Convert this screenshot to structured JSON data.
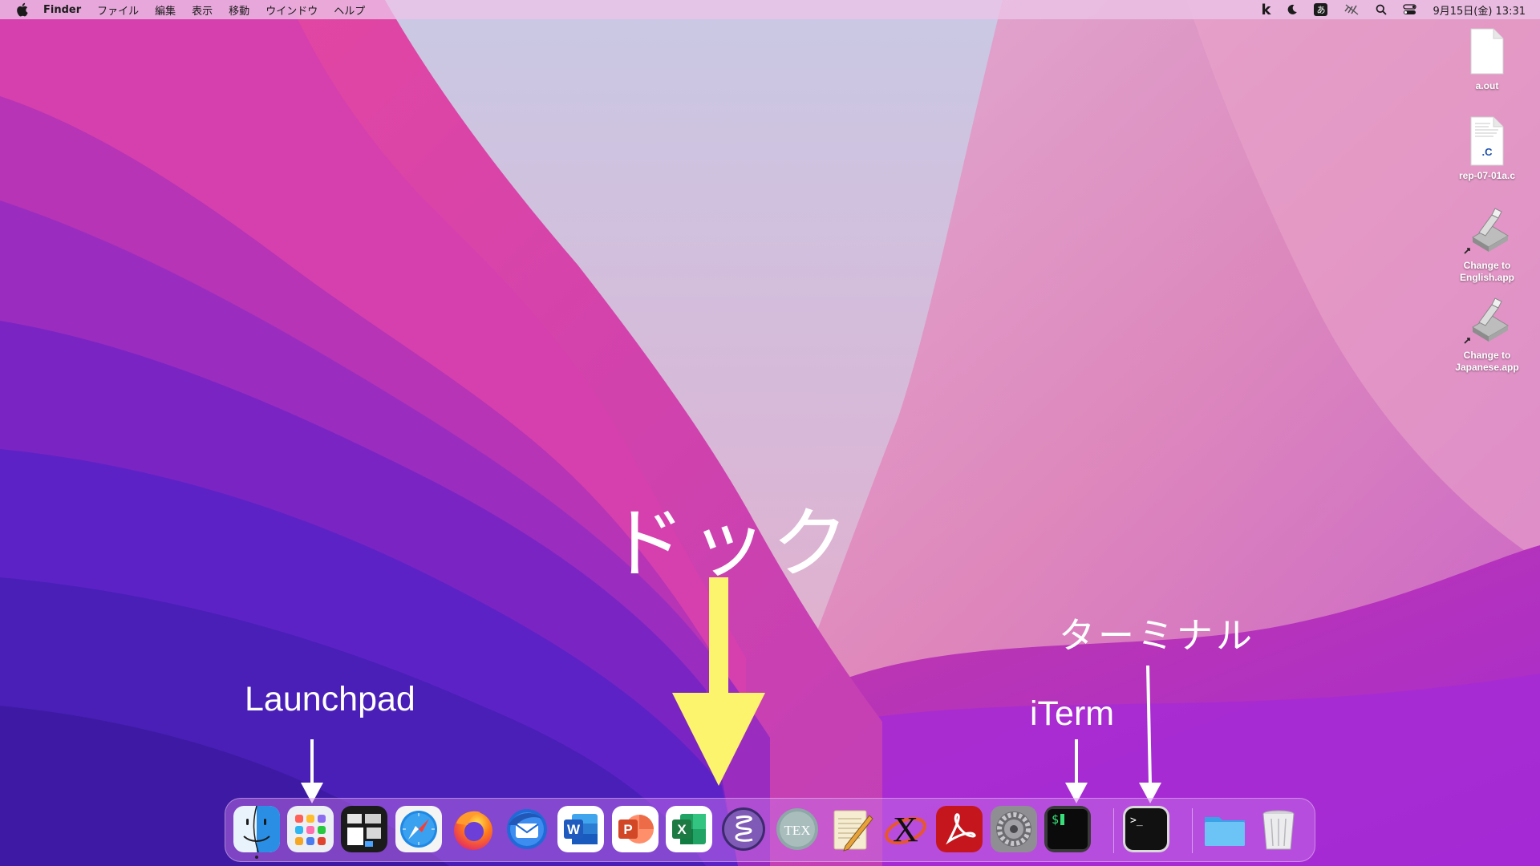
{
  "menubar": {
    "apple_icon": "apple-logo-icon",
    "app_name": "Finder",
    "menus": [
      "ファイル",
      "編集",
      "表示",
      "移動",
      "ウインドウ",
      "ヘルプ"
    ],
    "status_icons": [
      "k-icon",
      "moon-icon",
      "input-method-icon",
      "mute-icon",
      "search-icon",
      "control-center-icon"
    ],
    "input_method_glyph": "あ",
    "k_glyph": "k",
    "clock": "9月15日(金)  13:31"
  },
  "desktop_icons": [
    {
      "label": "a.out",
      "icon": "document-icon"
    },
    {
      "label": "rep-07-01a.c",
      "icon": "c-source-file-icon",
      "badge": ".C"
    },
    {
      "label_line1": "Change to",
      "label_line2": "English.app",
      "icon": "applescript-app-icon"
    },
    {
      "label_line1": "Change to",
      "label_line2": "Japanese.app",
      "icon": "applescript-app-icon"
    }
  ],
  "annotations": {
    "dock": "ドック",
    "launchpad": "Launchpad",
    "iterm": "iTerm",
    "terminal": "ターミナル"
  },
  "dock": {
    "apps": [
      {
        "name": "Finder",
        "icon": "finder-icon",
        "running": true
      },
      {
        "name": "Launchpad",
        "icon": "launchpad-icon"
      },
      {
        "name": "Mission Control",
        "icon": "mission-control-icon"
      },
      {
        "name": "Safari",
        "icon": "safari-icon"
      },
      {
        "name": "Firefox",
        "icon": "firefox-icon"
      },
      {
        "name": "Thunderbird",
        "icon": "thunderbird-icon"
      },
      {
        "name": "Word",
        "icon": "word-icon",
        "letter": "W"
      },
      {
        "name": "PowerPoint",
        "icon": "powerpoint-icon",
        "letter": "P"
      },
      {
        "name": "Excel",
        "icon": "excel-icon",
        "letter": "X"
      },
      {
        "name": "Emacs",
        "icon": "emacs-icon"
      },
      {
        "name": "TeX",
        "icon": "tex-icon",
        "letter": "TEX"
      },
      {
        "name": "TextEdit",
        "icon": "textedit-icon"
      },
      {
        "name": "XQuartz",
        "icon": "xquartz-icon",
        "letter": "X"
      },
      {
        "name": "Acrobat Reader",
        "icon": "acrobat-icon"
      },
      {
        "name": "System Preferences",
        "icon": "system-preferences-icon"
      },
      {
        "name": "iTerm",
        "icon": "iterm-icon",
        "glyph": "$"
      },
      {
        "name": "Terminal",
        "icon": "terminal-icon",
        "glyph": ">_"
      },
      {
        "name": "Folder",
        "icon": "folder-icon"
      },
      {
        "name": "Trash",
        "icon": "trash-icon"
      }
    ]
  },
  "colors": {
    "arrow_yellow": "#fdf46e",
    "arrow_white": "#ffffff",
    "word_blue": "#1f5bbf",
    "powerpoint_red": "#d24726",
    "excel_green": "#1d7a43",
    "acrobat_red": "#c4161c"
  }
}
